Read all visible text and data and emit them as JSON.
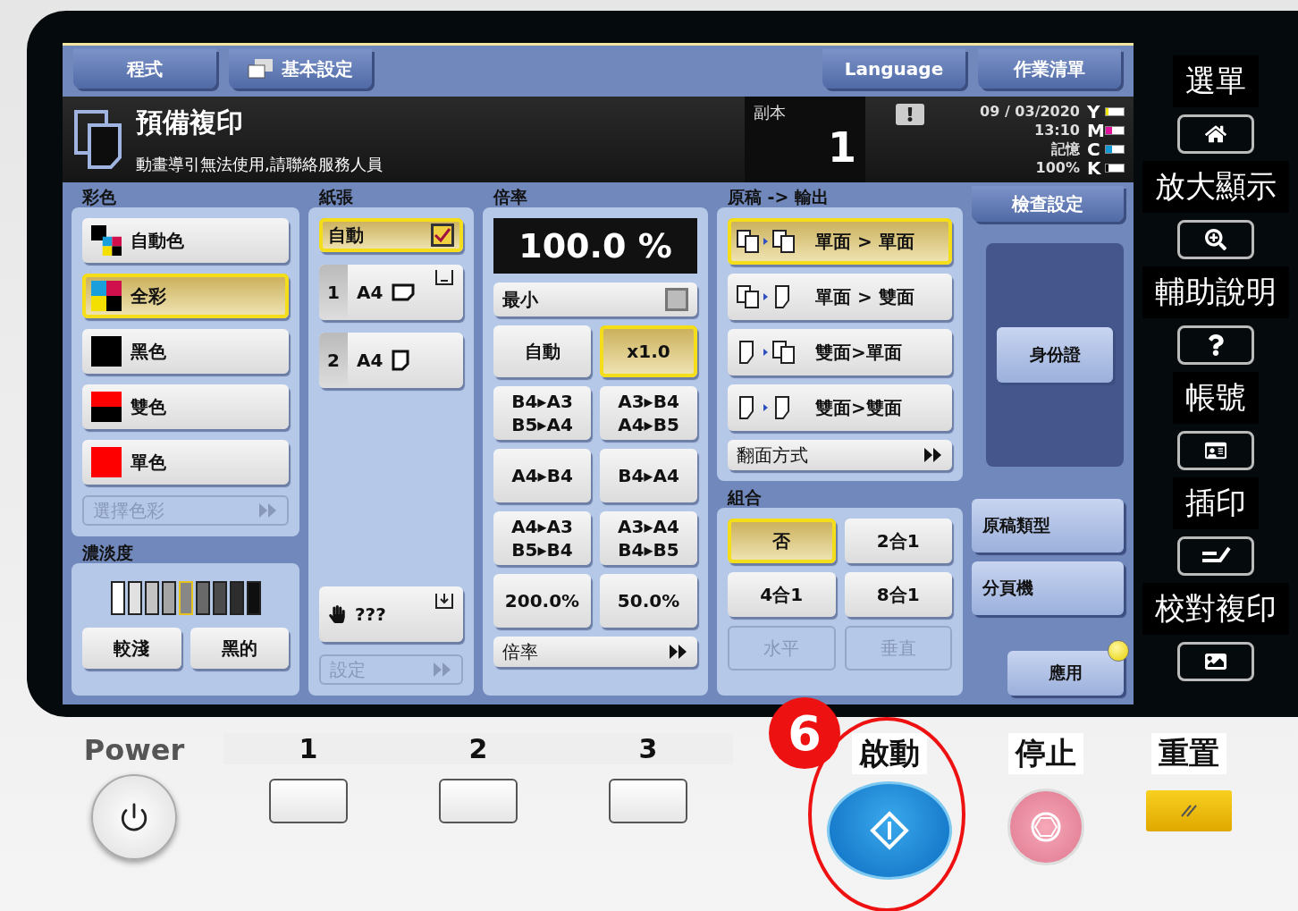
{
  "top_tabs": [
    {
      "label": "程式",
      "kind": "plain"
    },
    {
      "label": "基本設定",
      "kind": "with-icon"
    },
    {
      "label": "Language",
      "kind": "plain"
    },
    {
      "label": "作業清單",
      "kind": "plain"
    }
  ],
  "status": {
    "title": "預備複印",
    "message": "動畫導引無法使用,請聯絡服務人員",
    "copies_label": "副本",
    "copies": "1",
    "date": "09 / 03/2020",
    "time": "13:10",
    "memory_label": "記憶",
    "memory": "100%",
    "toners": [
      {
        "label": "Y",
        "color": "#f2e600",
        "level": 0.15
      },
      {
        "label": "M",
        "color": "#e0149c",
        "level": 0.35
      },
      {
        "label": "C",
        "color": "#129ad8",
        "level": 0.35
      },
      {
        "label": "K",
        "color": "#000000",
        "level": 0.15
      }
    ]
  },
  "color_panel": {
    "title": "彩色",
    "options": [
      {
        "label": "自動色",
        "kind": "auto",
        "selected": false
      },
      {
        "label": "全彩",
        "kind": "full",
        "selected": true
      },
      {
        "label": "黑色",
        "kind": "black",
        "selected": false
      },
      {
        "label": "雙色",
        "kind": "two",
        "selected": false
      },
      {
        "label": "單色",
        "kind": "single",
        "selected": false
      }
    ],
    "select_button": {
      "label": "選擇色彩",
      "disabled": true
    }
  },
  "density": {
    "title": "濃淡度",
    "level": 0.5,
    "buttons": [
      "較淺",
      "黑的"
    ]
  },
  "paper": {
    "title": "紙張",
    "auto": {
      "label": "自動",
      "selected": true,
      "checked": true
    },
    "trays": [
      {
        "number": "1",
        "size": "A4",
        "kind": "landscape",
        "selected": false
      },
      {
        "number": "2",
        "size": "A4",
        "kind": "portrait",
        "selected": false
      }
    ],
    "manual": {
      "label": "???",
      "selected": false
    },
    "settings_button": {
      "label": "設定",
      "disabled": true
    }
  },
  "zoom": {
    "title": "倍率",
    "display": "100.0 %",
    "minimum": {
      "label": "最小",
      "checked": false
    },
    "buttons": [
      {
        "lines": [
          "自動"
        ],
        "selected": false
      },
      {
        "lines": [
          "x1.0"
        ],
        "selected": true
      },
      {
        "lines": [
          "B4▸A3",
          "B5▸A4"
        ],
        "selected": false
      },
      {
        "lines": [
          "A3▸B4",
          "A4▸B5"
        ],
        "selected": false
      },
      {
        "lines": [
          "A4▸B4"
        ],
        "selected": false
      },
      {
        "lines": [
          "B4▸A4"
        ],
        "selected": false
      },
      {
        "lines": [
          "A4▸A3",
          "B5▸B4"
        ],
        "selected": false
      },
      {
        "lines": [
          "A3▸A4",
          "B4▸B5"
        ],
        "selected": false
      },
      {
        "lines": [
          "200.0%"
        ],
        "selected": false
      },
      {
        "lines": [
          "50.0%"
        ],
        "selected": false
      }
    ],
    "more_button": {
      "label": "倍率"
    }
  },
  "duplex": {
    "title": "原稿 -> 輸出",
    "options": [
      {
        "label": "單面 > 單面",
        "kind": "s2s",
        "selected": true
      },
      {
        "label": "單面 > 雙面",
        "kind": "s2d",
        "selected": false
      },
      {
        "label": "雙面>單面",
        "kind": "d2s",
        "selected": false
      },
      {
        "label": "雙面>雙面",
        "kind": "d2d",
        "selected": false
      }
    ],
    "flip_button": {
      "label": "翻面方式"
    }
  },
  "combine": {
    "title": "組合",
    "options": [
      {
        "label": "否",
        "selected": true
      },
      {
        "label": "2合1",
        "selected": false
      },
      {
        "label": "4合1",
        "selected": false
      },
      {
        "label": "8合1",
        "selected": false
      }
    ],
    "layout": [
      {
        "label": "水平",
        "disabled": true
      },
      {
        "label": "垂直",
        "disabled": true
      }
    ]
  },
  "side_panel": {
    "check_settings": "檢查設定",
    "id_card": "身份證",
    "original_type": "原稿類型",
    "separator": "分頁機",
    "apply": "應用",
    "apply_indicator": true
  },
  "hard_keys": [
    {
      "label": "選單",
      "kind": "home"
    },
    {
      "label": "放大顯示",
      "kind": "zoom"
    },
    {
      "label": "輔助說明",
      "kind": "help"
    },
    {
      "label": "帳號",
      "kind": "account"
    },
    {
      "label": "插印",
      "kind": "interrupt"
    },
    {
      "label": "校對複印",
      "kind": "proof"
    }
  ],
  "bottom": {
    "power_label": "Power",
    "register_keys": [
      {
        "label": "1"
      },
      {
        "label": "2"
      },
      {
        "label": "3"
      }
    ],
    "start_label": "啟動",
    "stop_label": "停止",
    "reset_label": "重置",
    "callout": "6"
  }
}
